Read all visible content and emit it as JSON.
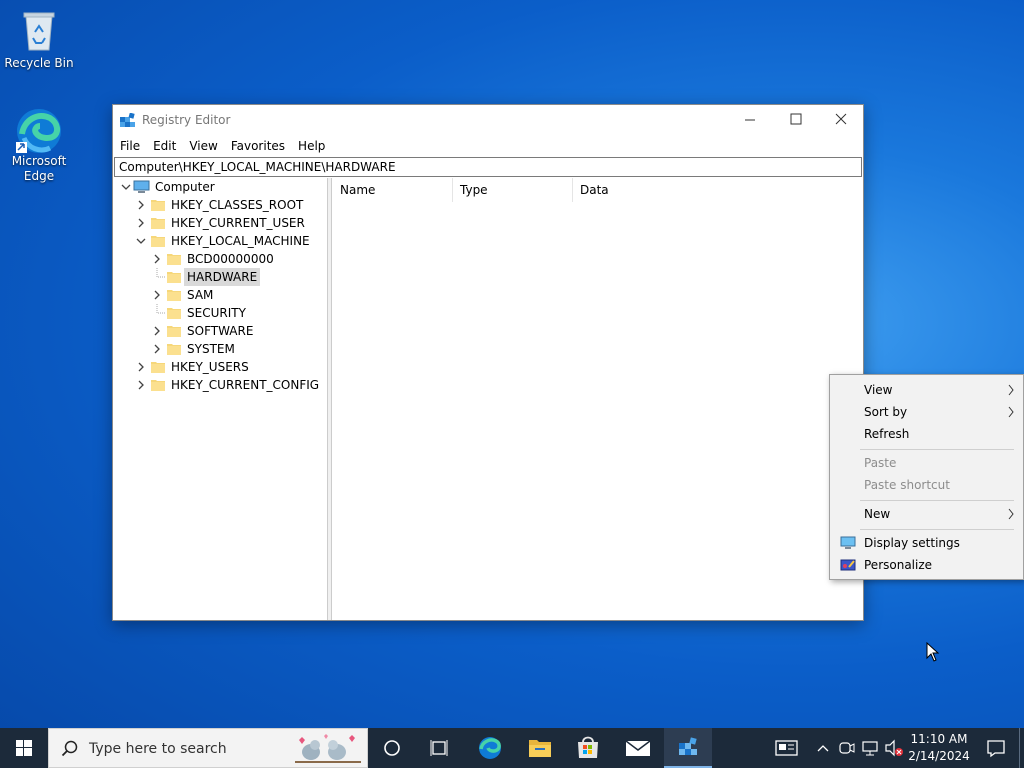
{
  "desktop": {
    "icons": [
      {
        "label": "Recycle Bin"
      },
      {
        "label": "Microsoft Edge"
      }
    ]
  },
  "window": {
    "title": "Registry Editor",
    "menu": [
      "File",
      "Edit",
      "View",
      "Favorites",
      "Help"
    ],
    "address": "Computer\\HKEY_LOCAL_MACHINE\\HARDWARE",
    "tree": {
      "root": "Computer",
      "hives": [
        "HKEY_CLASSES_ROOT",
        "HKEY_CURRENT_USER",
        "HKEY_LOCAL_MACHINE",
        "HKEY_USERS",
        "HKEY_CURRENT_CONFIG"
      ],
      "local_machine_children": [
        "BCD00000000",
        "HARDWARE",
        "SAM",
        "SECURITY",
        "SOFTWARE",
        "SYSTEM"
      ],
      "selected": "HARDWARE"
    },
    "columns": [
      "Name",
      "Type",
      "Data"
    ]
  },
  "context_menu": {
    "items": [
      {
        "label": "View",
        "submenu": true,
        "enabled": true
      },
      {
        "label": "Sort by",
        "submenu": true,
        "enabled": true
      },
      {
        "label": "Refresh",
        "submenu": false,
        "enabled": true
      },
      {
        "label": "Paste",
        "submenu": false,
        "enabled": false
      },
      {
        "label": "Paste shortcut",
        "submenu": false,
        "enabled": false
      },
      {
        "label": "New",
        "submenu": true,
        "enabled": true
      },
      {
        "label": "Display settings",
        "submenu": false,
        "enabled": true,
        "icon": "display-icon"
      },
      {
        "label": "Personalize",
        "submenu": false,
        "enabled": true,
        "icon": "personalize-icon"
      }
    ]
  },
  "taskbar": {
    "search_placeholder": "Type here to search",
    "time": "11:10 AM",
    "date": "2/14/2024",
    "pinned": [
      "task-view-icon",
      "edge-icon",
      "file-explorer-icon",
      "store-icon",
      "mail-icon",
      "registry-editor-icon"
    ]
  },
  "colors": {
    "accent": "#0078d4",
    "taskbar": "#1c2a3a",
    "selection": "#d9d9d9"
  }
}
